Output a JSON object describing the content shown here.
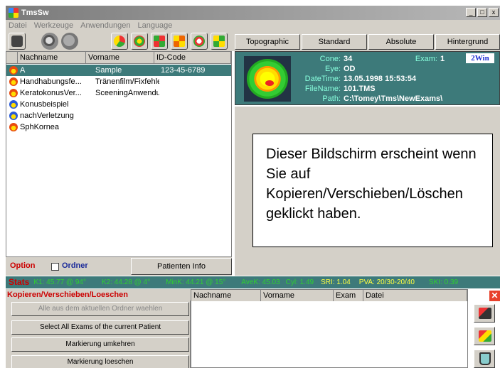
{
  "window": {
    "title": "TmsSw"
  },
  "menu": [
    "Datei",
    "Werkzeuge",
    "Anwendungen",
    "Language"
  ],
  "tabs": [
    "Topographic",
    "Standard",
    "Absolute",
    "Hintergrund"
  ],
  "patient_list": {
    "columns": [
      "Nachname",
      "Vorname",
      "ID-Code"
    ],
    "rows": [
      {
        "nachname": "A",
        "vorname": "Sample",
        "id": "123-45-6789",
        "icon": "face-red-icon"
      },
      {
        "nachname": "Handhabungsfe...",
        "vorname": "Tränenfilm/Fixfehler",
        "id": "",
        "icon": "face-red-icon"
      },
      {
        "nachname": "KeratokonusVer...",
        "vorname": "SceeningAnwendung!",
        "id": "",
        "icon": "face-red-icon"
      },
      {
        "nachname": "Konusbeispiel",
        "vorname": "",
        "id": "",
        "icon": "face-blue-icon"
      },
      {
        "nachname": "nachVerletzung",
        "vorname": "",
        "id": "",
        "icon": "face-blue-icon"
      },
      {
        "nachname": "SphKornea",
        "vorname": "",
        "id": "",
        "icon": "face-red-icon"
      }
    ]
  },
  "option": {
    "label": "Option",
    "checkbox_label": "Ordner",
    "button": "Patienten Info"
  },
  "info": {
    "cone_label": "Cone:",
    "cone": "34",
    "exam_label": "Exam:",
    "exam": "1",
    "eye_label": "Eye:",
    "eye": "OD",
    "datetime_label": "DateTime:",
    "datetime": "13.05.1998 15:53:54",
    "filename_label": "FileName:",
    "filename": "101.TMS",
    "path_label": "Path:",
    "path": "C:\\Tomey\\Tms\\NewExams\\",
    "badge": "2Win"
  },
  "callout": "Dieser Bildschirm erscheint wenn Sie auf Kopieren/Verschieben/Löschen geklickt haben.",
  "stats": {
    "label": "Stats",
    "k1": "K1: 45.77 @ 94°",
    "k2": "K2: 44.28 @ 4°",
    "mink": "MinK: 44.21 @ 15°",
    "avek": "AveK: 45.03",
    "cyl": "Cyl: 1.49",
    "sri": "SRI: 1.04",
    "pva": "PVA: 20/30-20/40",
    "ski": "SKI: 0.39"
  },
  "copy_panel": {
    "title": "Kopieren/Verschieben/Loeschen",
    "buttons": [
      "Alle aus dem aktuellen Ordner waehlen",
      "Select All Exams of the current Patient",
      "Markierung umkehren",
      "Markierung loeschen"
    ]
  },
  "target_list": {
    "columns": [
      "Nachname",
      "Vorname",
      "Exam",
      "Datei"
    ]
  },
  "colors": {
    "teal": "#3d7a7a",
    "stats_green": "#2fd02f",
    "stats_yellow": "#ffff40",
    "title_red": "#cc0000"
  }
}
